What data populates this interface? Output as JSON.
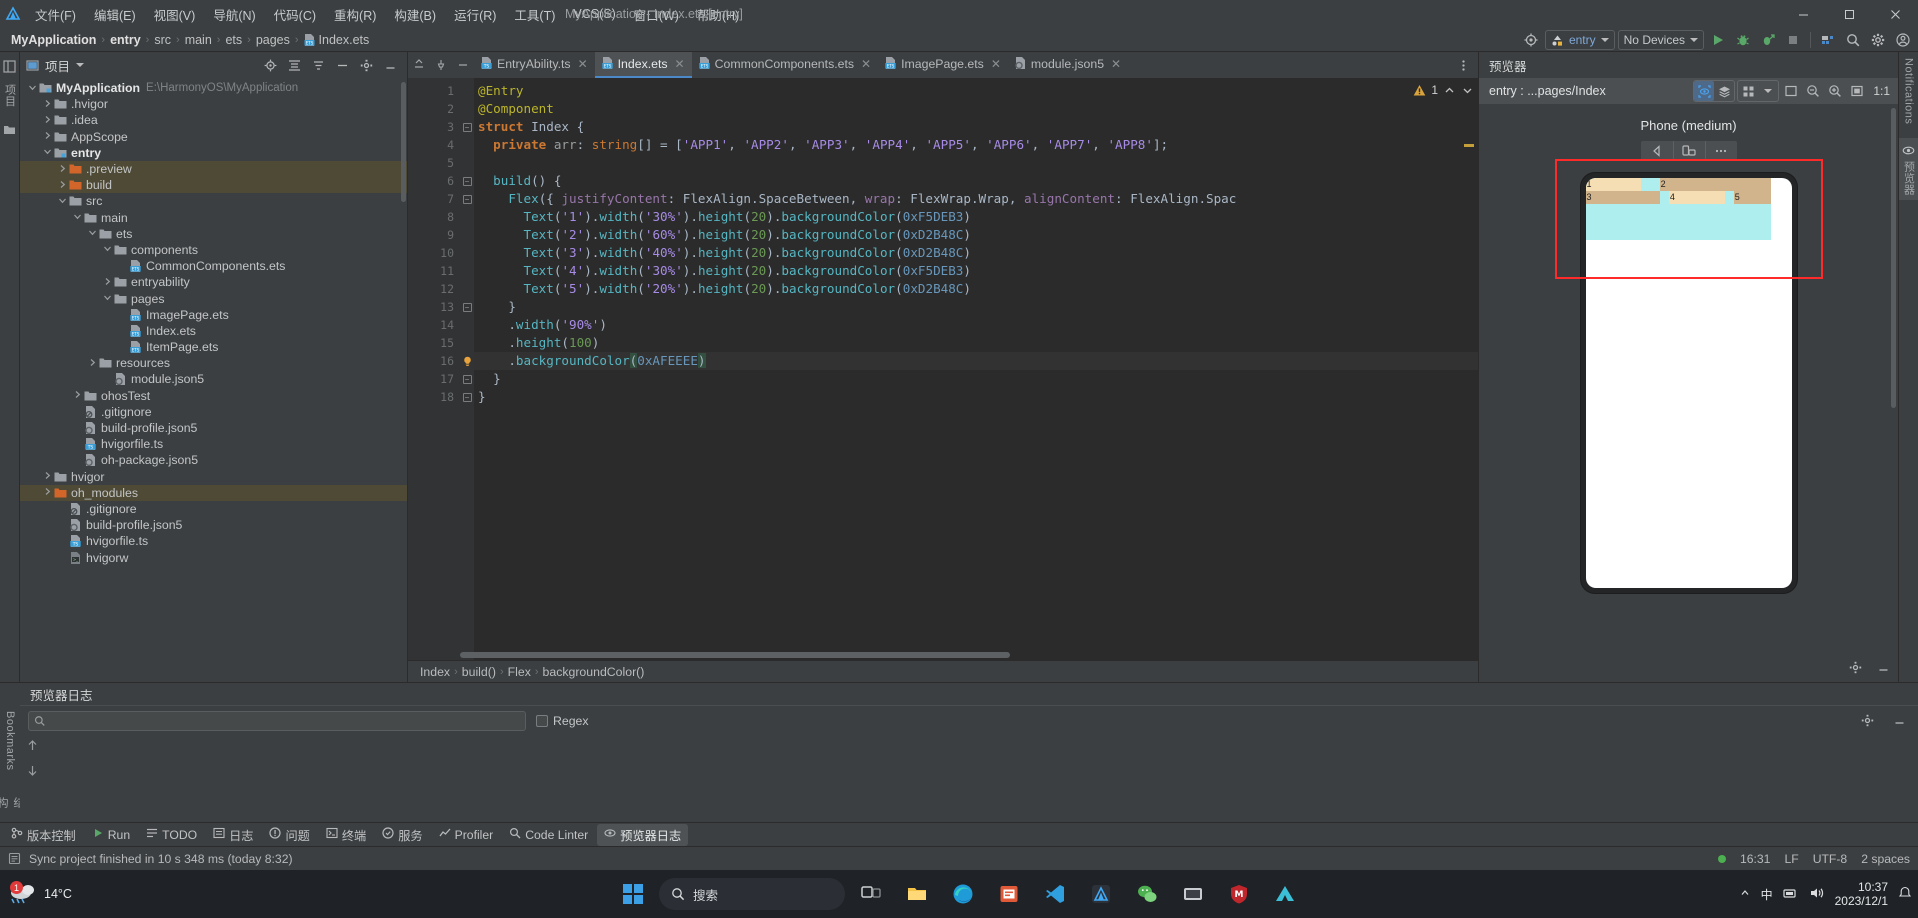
{
  "window": {
    "title": "MyApplication - Index.ets [entry]",
    "minimize": "—",
    "maximize": "□",
    "close": "✕"
  },
  "menu": {
    "items": [
      "文件(F)",
      "编辑(E)",
      "视图(V)",
      "导航(N)",
      "代码(C)",
      "重构(R)",
      "构建(B)",
      "运行(R)",
      "工具(T)",
      "VCS(S)",
      "窗口(W)",
      "帮助(H)"
    ]
  },
  "breadcrumb": {
    "items": [
      "MyApplication",
      "entry",
      "src",
      "main",
      "ets",
      "pages"
    ],
    "file": "Index.ets",
    "separator": "›"
  },
  "toolbar": {
    "target_label": "entry",
    "device_label": "No Devices",
    "icons": [
      "inspection-icon",
      "run-icon",
      "debug-icon",
      "profile-debug-icon",
      "stop-icon",
      "device-manager-icon",
      "search-everywhere-icon",
      "settings-icon",
      "account-icon"
    ]
  },
  "project_pane": {
    "title": "项目",
    "header_icons": [
      "locate-icon",
      "collapse-all-icon",
      "hide-icon",
      "settings-icon",
      "minimize-icon"
    ],
    "tree": [
      {
        "label": "MyApplication",
        "suffix": "E:\\HarmonyOS\\MyApplication",
        "depth": 0,
        "arrow": "down",
        "icon": "module-folder",
        "bold": true,
        "hl": false
      },
      {
        "label": ".hvigor",
        "suffix": "",
        "depth": 1,
        "arrow": "right",
        "icon": "folder-gray",
        "bold": false,
        "hl": false
      },
      {
        "label": ".idea",
        "suffix": "",
        "depth": 1,
        "arrow": "right",
        "icon": "folder-gray",
        "bold": false,
        "hl": false
      },
      {
        "label": "AppScope",
        "suffix": "",
        "depth": 1,
        "arrow": "right",
        "icon": "folder-gray",
        "bold": false,
        "hl": false
      },
      {
        "label": "entry",
        "suffix": "",
        "depth": 1,
        "arrow": "down",
        "icon": "module-folder",
        "bold": true,
        "hl": false
      },
      {
        "label": ".preview",
        "suffix": "",
        "depth": 2,
        "arrow": "right",
        "icon": "folder-orange",
        "bold": false,
        "hl": true
      },
      {
        "label": "build",
        "suffix": "",
        "depth": 2,
        "arrow": "right",
        "icon": "folder-orange",
        "bold": false,
        "hl": true
      },
      {
        "label": "src",
        "suffix": "",
        "depth": 2,
        "arrow": "down",
        "icon": "folder-gray",
        "bold": false,
        "hl": false
      },
      {
        "label": "main",
        "suffix": "",
        "depth": 3,
        "arrow": "down",
        "icon": "folder-gray",
        "bold": false,
        "hl": false
      },
      {
        "label": "ets",
        "suffix": "",
        "depth": 4,
        "arrow": "down",
        "icon": "folder-gray",
        "bold": false,
        "hl": false
      },
      {
        "label": "components",
        "suffix": "",
        "depth": 5,
        "arrow": "down",
        "icon": "folder-gray",
        "bold": false,
        "hl": false
      },
      {
        "label": "CommonComponents.ets",
        "suffix": "",
        "depth": 6,
        "arrow": "none",
        "icon": "ets-file",
        "bold": false,
        "hl": false
      },
      {
        "label": "entryability",
        "suffix": "",
        "depth": 5,
        "arrow": "right",
        "icon": "folder-gray",
        "bold": false,
        "hl": false
      },
      {
        "label": "pages",
        "suffix": "",
        "depth": 5,
        "arrow": "down",
        "icon": "folder-gray",
        "bold": false,
        "hl": false
      },
      {
        "label": "ImagePage.ets",
        "suffix": "",
        "depth": 6,
        "arrow": "none",
        "icon": "ets-file",
        "bold": false,
        "hl": false
      },
      {
        "label": "Index.ets",
        "suffix": "",
        "depth": 6,
        "arrow": "none",
        "icon": "ets-file",
        "bold": false,
        "hl": false
      },
      {
        "label": "ItemPage.ets",
        "suffix": "",
        "depth": 6,
        "arrow": "none",
        "icon": "ets-file",
        "bold": false,
        "hl": false
      },
      {
        "label": "resources",
        "suffix": "",
        "depth": 4,
        "arrow": "right",
        "icon": "folder-gray",
        "bold": false,
        "hl": false
      },
      {
        "label": "module.json5",
        "suffix": "",
        "depth": 5,
        "arrow": "none",
        "icon": "json5-file",
        "bold": false,
        "hl": false
      },
      {
        "label": "ohosTest",
        "suffix": "",
        "depth": 3,
        "arrow": "right",
        "icon": "folder-gray",
        "bold": false,
        "hl": false
      },
      {
        "label": ".gitignore",
        "suffix": "",
        "depth": 3,
        "arrow": "none",
        "icon": "gitignore-file",
        "bold": false,
        "hl": false
      },
      {
        "label": "build-profile.json5",
        "suffix": "",
        "depth": 3,
        "arrow": "none",
        "icon": "json5-file",
        "bold": false,
        "hl": false
      },
      {
        "label": "hvigorfile.ts",
        "suffix": "",
        "depth": 3,
        "arrow": "none",
        "icon": "ts-file",
        "bold": false,
        "hl": false
      },
      {
        "label": "oh-package.json5",
        "suffix": "",
        "depth": 3,
        "arrow": "none",
        "icon": "json5-file",
        "bold": false,
        "hl": false
      },
      {
        "label": "hvigor",
        "suffix": "",
        "depth": 1,
        "arrow": "right",
        "icon": "folder-gray",
        "bold": false,
        "hl": false
      },
      {
        "label": "oh_modules",
        "suffix": "",
        "depth": 1,
        "arrow": "right",
        "icon": "folder-orange",
        "bold": false,
        "hl": true
      },
      {
        "label": ".gitignore",
        "suffix": "",
        "depth": 2,
        "arrow": "none",
        "icon": "gitignore-file",
        "bold": false,
        "hl": false
      },
      {
        "label": "build-profile.json5",
        "suffix": "",
        "depth": 2,
        "arrow": "none",
        "icon": "json5-file",
        "bold": false,
        "hl": false
      },
      {
        "label": "hvigorfile.ts",
        "suffix": "",
        "depth": 2,
        "arrow": "none",
        "icon": "ts-file",
        "bold": false,
        "hl": false
      },
      {
        "label": "hvigorw",
        "suffix": "",
        "depth": 2,
        "arrow": "none",
        "icon": "script-file",
        "bold": false,
        "hl": false
      }
    ]
  },
  "editor": {
    "tabs": [
      {
        "label": "EntryAbility.ts",
        "icon": "ts-file",
        "active": false
      },
      {
        "label": "Index.ets",
        "icon": "ets-file",
        "active": true
      },
      {
        "label": "CommonComponents.ets",
        "icon": "ets-file",
        "active": false
      },
      {
        "label": "ImagePage.ets",
        "icon": "ets-file",
        "active": false
      },
      {
        "label": "module.json5",
        "icon": "json5-file",
        "active": false
      }
    ],
    "warning_count": "1",
    "line_numbers": [
      "1",
      "2",
      "3",
      "4",
      "5",
      "6",
      "7",
      "8",
      "9",
      "10",
      "11",
      "12",
      "13",
      "14",
      "15",
      "16",
      "17",
      "18"
    ],
    "code": [
      "@Entry",
      "@Component",
      "struct Index {",
      "  private arr: string[] = ['APP1', 'APP2', 'APP3', 'APP4', 'APP5', 'APP6', 'APP7', 'APP8'];",
      "",
      "  build() {",
      "    Flex({ justifyContent: FlexAlign.SpaceBetween, wrap: FlexWrap.Wrap, alignContent: FlexAlign.Spac",
      "      Text('1').width('30%').height(20).backgroundColor(0xF5DEB3)",
      "      Text('2').width('60%').height(20).backgroundColor(0xD2B48C)",
      "      Text('3').width('40%').height(20).backgroundColor(0xD2B48C)",
      "      Text('4').width('30%').height(20).backgroundColor(0xF5DEB3)",
      "      Text('5').width('20%').height(20).backgroundColor(0xD2B48C)",
      "    }",
      "    .width('90%')",
      "    .height(100)",
      "    .backgroundColor(0xAFEEEE)",
      "  }",
      "}"
    ],
    "bottom_breadcrumb": [
      "Index",
      "build()",
      "Flex",
      "backgroundColor()"
    ],
    "bottom_breadcrumb_sep": "›"
  },
  "previewer": {
    "title": "预览器",
    "path": "entry : ...pages/Index",
    "zoom_ratio": "1:1",
    "device_name": "Phone (medium)",
    "tool_icons": [
      "inspector-icon",
      "layers-icon",
      "multi-device-icon",
      "chevron-down-icon",
      "fit-icon",
      "zoom-out-icon",
      "zoom-in-icon",
      "actual-size-icon"
    ],
    "nav_icons": [
      "back-icon",
      "rotate-icon",
      "more-icon"
    ],
    "preview_bars": [
      {
        "label": "1",
        "width_pct": 30,
        "color": "#F5DEB3"
      },
      {
        "label": "2",
        "width_pct": 60,
        "color": "#D2B48C"
      },
      {
        "label": "3",
        "width_pct": 40,
        "color": "#D2B48C"
      },
      {
        "label": "4",
        "width_pct": 30,
        "color": "#F5DEB3"
      },
      {
        "label": "5",
        "width_pct": 20,
        "color": "#D2B48C"
      }
    ],
    "container_bg": "#AFEEEE",
    "highlight_color": "#ff2a2a"
  },
  "right_strip": {
    "items": [
      "Notifications",
      "预览器"
    ]
  },
  "left_strip": {
    "items": [
      "项目",
      "Bookmarks",
      "结构"
    ]
  },
  "log_panel": {
    "title": "预览器日志",
    "search_placeholder": "",
    "search_value": "",
    "regex_label": "Regex"
  },
  "tool_window_bar": {
    "items": [
      {
        "label": "版本控制",
        "icon": "vcs-icon",
        "active": false
      },
      {
        "label": "Run",
        "icon": "run-icon",
        "active": false
      },
      {
        "label": "TODO",
        "icon": "todo-icon",
        "active": false
      },
      {
        "label": "日志",
        "icon": "log-icon",
        "active": false
      },
      {
        "label": "问题",
        "icon": "problems-icon",
        "active": false
      },
      {
        "label": "终端",
        "icon": "terminal-icon",
        "active": false
      },
      {
        "label": "服务",
        "icon": "services-icon",
        "active": false
      },
      {
        "label": "Profiler",
        "icon": "profiler-icon",
        "active": false
      },
      {
        "label": "Code Linter",
        "icon": "linter-icon",
        "active": false
      },
      {
        "label": "预览器日志",
        "icon": "preview-log-icon",
        "active": true
      }
    ]
  },
  "status_bar": {
    "message": "Sync project finished in 10 s 348 ms (today 8:32)",
    "time": "16:31",
    "line_sep": "LF",
    "encoding": "UTF-8",
    "indent": "2 spaces"
  },
  "taskbar": {
    "weather_temp": "14°C",
    "weather_desc": "",
    "search_text": "搜索",
    "apps": [
      "start-icon",
      "search-icon",
      "task-view-icon",
      "file-explorer-icon",
      "edge-icon",
      "store-icon",
      "vscode-icon",
      "deveco-icon",
      "wechat-icon",
      "video-icon",
      "mcafee-icon",
      "drive-icon"
    ],
    "clock_time": "10:37",
    "clock_date": "2023/12/1",
    "ime": "中",
    "notification_badge": "1"
  }
}
